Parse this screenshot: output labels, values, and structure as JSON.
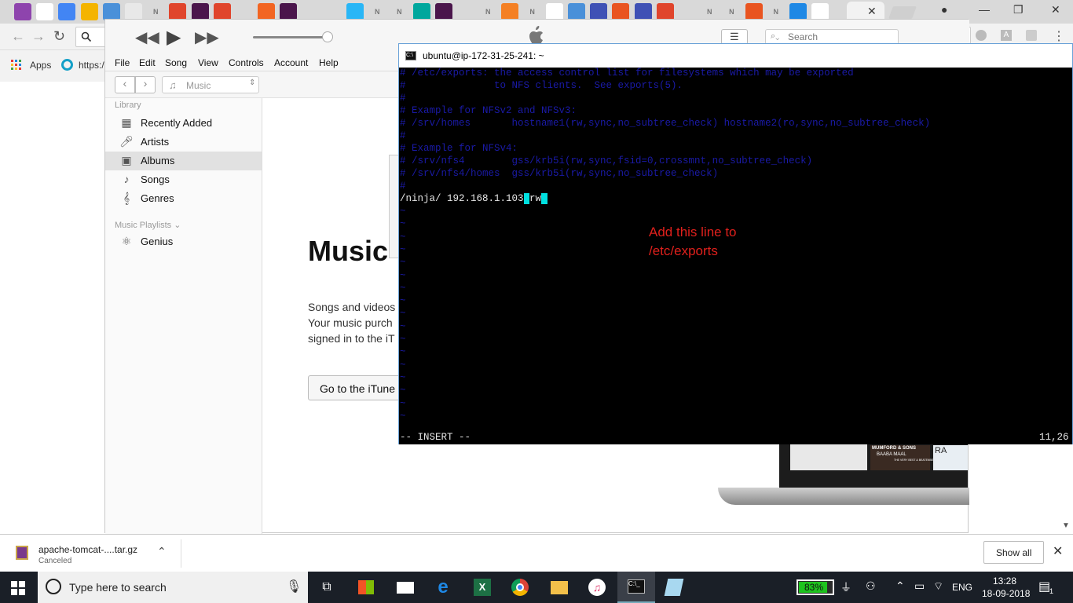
{
  "chrome": {
    "tab_icons": [
      "pen",
      "gmail",
      "docs",
      "box",
      "chromium",
      "image",
      "ninja",
      "ask",
      "slack",
      "ask",
      "heart",
      "vs",
      "slack",
      "doc",
      "doc",
      "fb",
      "ninja",
      "ninja",
      "teal",
      "slack",
      "github",
      "ninja",
      "so",
      "ninja",
      "google",
      "chromium",
      "bracket",
      "ubuntu",
      "bracket",
      "ask",
      "android",
      "ninja",
      "ninja",
      "ubuntu",
      "ninja",
      "drive",
      "google"
    ],
    "tab_text_glyph": "N",
    "url_text": "https:/",
    "bookmarks_apps": "Apps"
  },
  "itunes": {
    "menus": [
      "File",
      "Edit",
      "Song",
      "View",
      "Controls",
      "Account",
      "Help"
    ],
    "media_picker": "Music",
    "search_placeholder": "Search",
    "library_header": "Library",
    "library_items": [
      {
        "label": "Recently Added",
        "icon": "grid-icon"
      },
      {
        "label": "Artists",
        "icon": "mic-icon"
      },
      {
        "label": "Albums",
        "icon": "album-icon"
      },
      {
        "label": "Songs",
        "icon": "note-icon"
      },
      {
        "label": "Genres",
        "icon": "guitar-icon"
      }
    ],
    "playlists_header": "Music Playlists",
    "playlist_items": [
      {
        "label": "Genius",
        "icon": "atom-icon"
      }
    ],
    "main_heading": "Music",
    "main_text": [
      "Songs and videos",
      "Your music purch",
      "signed in to the iT"
    ],
    "store_button": "Go to the iTune",
    "albums": [
      "MUMFORD & SONS",
      "BAABA MAAL",
      "THE VERY BEST & BEATENBERG",
      "RA"
    ]
  },
  "terminal": {
    "title": "ubuntu@ip-172-31-25-241: ~",
    "lines": [
      "# /etc/exports: the access control list for filesystems which may be exported",
      "#               to NFS clients.  See exports(5).",
      "#",
      "# Example for NFSv2 and NFSv3:",
      "# /srv/homes       hostname1(rw,sync,no_subtree_check) hostname2(ro,sync,no_subtree_check)",
      "#",
      "# Example for NFSv4:",
      "# /srv/nfs4        gss/krb5i(rw,sync,fsid=0,crossmnt,no_subtree_check)",
      "# /srv/nfs4/homes  gss/krb5i(rw,sync,no_subtree_check)",
      "#"
    ],
    "active_line_prefix": "/ninja/ 192.168.1.103",
    "active_line_cursor": " ",
    "active_line_suffix": "rw",
    "annotation_line1": "Add this line to",
    "annotation_line2": "/etc/exports",
    "mode": "-- INSERT --",
    "position": "11,26"
  },
  "download": {
    "filename": "apache-tomcat-....tar.gz",
    "status": "Canceled",
    "show_all": "Show all"
  },
  "taskbar": {
    "search_placeholder": "Type here to search",
    "battery": "83%",
    "language": "ENG",
    "time": "13:28",
    "date": "18-09-2018",
    "notification_count": "1"
  },
  "colors": {
    "terminal_comment": "#1a1aa6",
    "annotation": "#e0201c",
    "cursor": "#00e0e0",
    "taskbar": "#1a1f27"
  }
}
